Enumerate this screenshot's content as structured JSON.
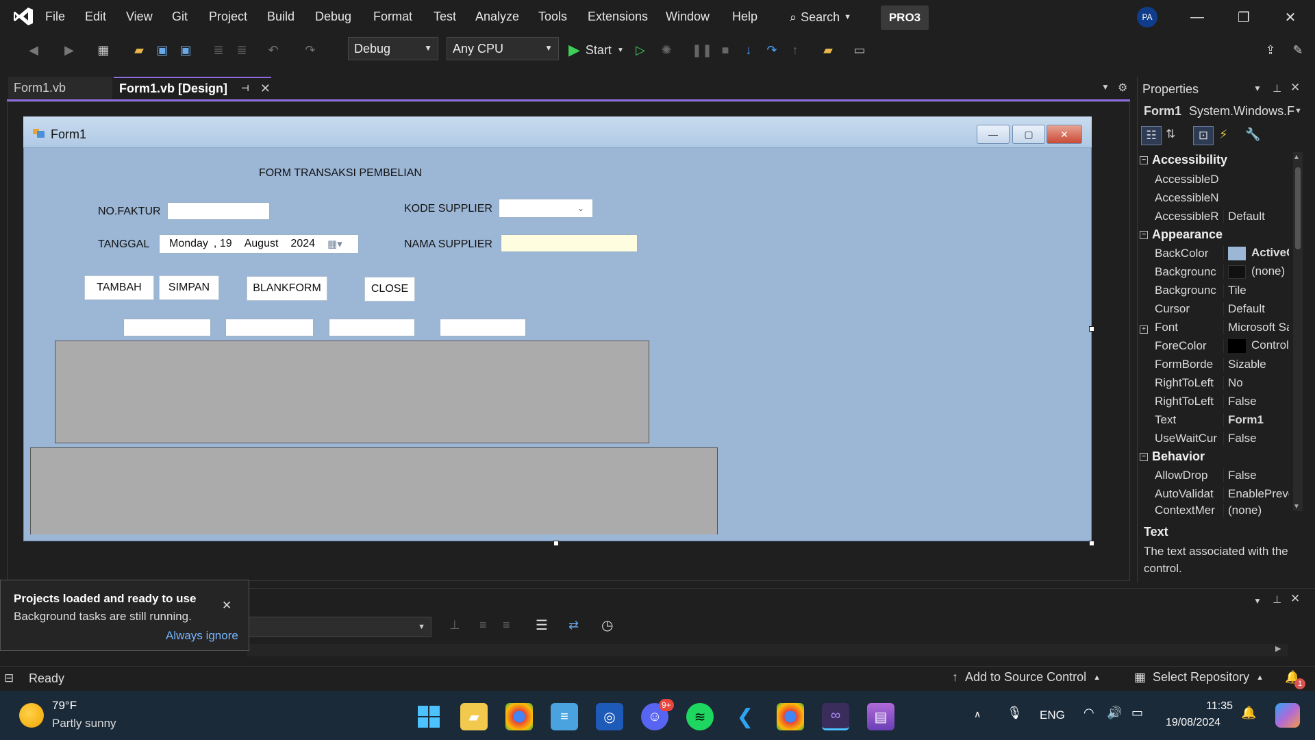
{
  "menu": {
    "items": [
      "File",
      "Edit",
      "View",
      "Git",
      "Project",
      "Build",
      "Debug",
      "Format",
      "Test",
      "Analyze",
      "Tools",
      "Extensions",
      "Window",
      "Help"
    ],
    "search_label": "Search",
    "solution_badge": "PRO3",
    "avatar_initials": "PA"
  },
  "toolbar": {
    "config_value": "Debug",
    "platform_value": "Any CPU",
    "start_label": "Start"
  },
  "tabs": [
    {
      "label": "Form1.vb"
    },
    {
      "label": "Form1.vb [Design]"
    }
  ],
  "form": {
    "title": "Form1",
    "heading": "FORM TRANSAKSI PEMBELIAN",
    "labels": {
      "no_faktur": "NO.FAKTUR",
      "tanggal": "TANGGAL",
      "kode_supplier": "KODE SUPPLIER",
      "nama_supplier": "NAMA SUPPLIER"
    },
    "date": {
      "day_name": "Monday",
      "day": ", 19",
      "month": "August",
      "year": "2024"
    },
    "buttons": {
      "tambah": "TAMBAH",
      "simpan": "SIMPAN",
      "blankform": "BLANKFORM",
      "close": "CLOSE"
    }
  },
  "properties": {
    "title": "Properties",
    "object_name": "Form1",
    "object_type": "System.Windows.F",
    "categories": [
      {
        "name": "Accessibility",
        "rows": [
          {
            "name": "AccessibleD",
            "value": ""
          },
          {
            "name": "AccessibleN",
            "value": ""
          },
          {
            "name": "AccessibleR",
            "value": "Default"
          }
        ]
      },
      {
        "name": "Appearance",
        "rows": [
          {
            "name": "BackColor",
            "value": "ActiveC"
          },
          {
            "name": "Backgrounc",
            "value": "(none)"
          },
          {
            "name": "Backgrounc",
            "value": "Tile"
          },
          {
            "name": "Cursor",
            "value": "Default"
          },
          {
            "name": "Font",
            "value": "Microsoft Sa"
          },
          {
            "name": "ForeColor",
            "value": "Control"
          },
          {
            "name": "FormBorde",
            "value": "Sizable"
          },
          {
            "name": "RightToLeft",
            "value": "No"
          },
          {
            "name": "RightToLeft",
            "value": "False"
          },
          {
            "name": "Text",
            "value": "Form1"
          },
          {
            "name": "UseWaitCur",
            "value": "False"
          }
        ]
      },
      {
        "name": "Behavior",
        "rows": [
          {
            "name": "AllowDrop",
            "value": "False"
          },
          {
            "name": "AutoValidat",
            "value": "EnablePrever"
          },
          {
            "name": "ContextMer",
            "value": "(none)"
          }
        ]
      }
    ],
    "description_title": "Text",
    "description": "The text associated with the control.",
    "colors": {
      "backcolor_swatch": "#9cb6d5",
      "black_swatch": "#000000"
    }
  },
  "toast": {
    "title": "Projects loaded and ready to use",
    "body": "Background tasks are still running.",
    "link": "Always ignore"
  },
  "status": {
    "ready": "Ready",
    "add_source": "Add to Source Control",
    "select_repo": "Select Repository",
    "notif_count": "1"
  },
  "taskbar": {
    "weather_temp": "79°F",
    "weather_desc": "Partly sunny",
    "lang": "ENG",
    "time": "11:35",
    "date": "19/08/2024",
    "discord_badge": "9+"
  },
  "colors": {
    "accent": "#8d6ce0",
    "form_back": "#9cb6d5",
    "start_green": "#3ecf5a"
  }
}
